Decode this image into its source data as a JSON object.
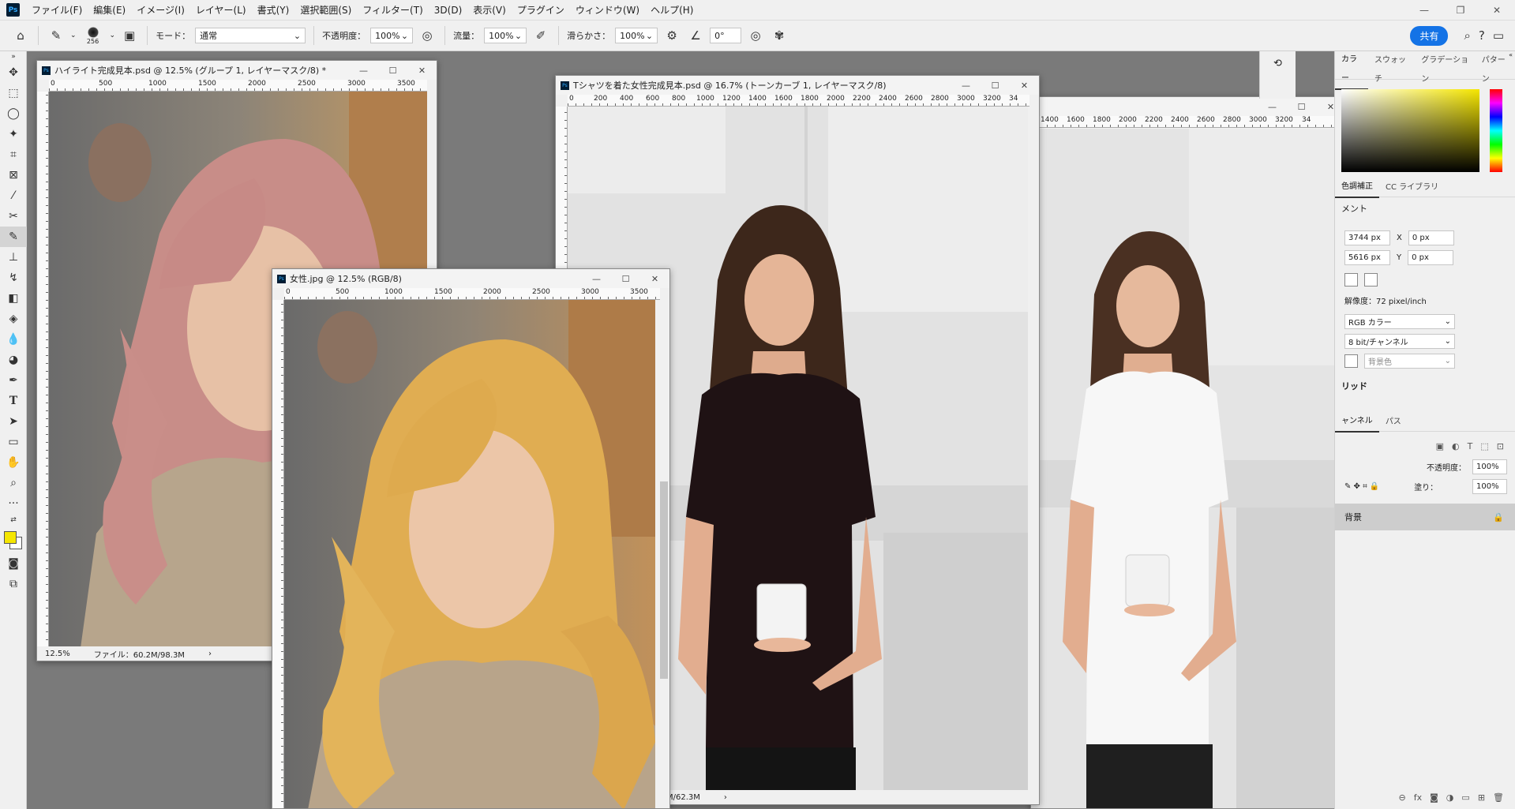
{
  "menubar": {
    "logo": "Ps",
    "items": [
      "ファイル(F)",
      "編集(E)",
      "イメージ(I)",
      "レイヤー(L)",
      "書式(Y)",
      "選択範囲(S)",
      "フィルター(T)",
      "3D(D)",
      "表示(V)",
      "プラグイン",
      "ウィンドウ(W)",
      "ヘルプ(H)"
    ]
  },
  "options": {
    "brush_size": "256",
    "mode_label": "モード：",
    "mode_value": "通常",
    "opacity_label": "不透明度：",
    "opacity_value": "100%",
    "flow_label": "流量：",
    "flow_value": "100%",
    "smoothing_label": "滑らかさ：",
    "smoothing_value": "100%",
    "angle_value": "0°",
    "share_label": "共有"
  },
  "docs": {
    "highlight": {
      "title": "ハイライト完成見本.psd @ 12.5% (グループ 1, レイヤーマスク/8) *",
      "ruler": [
        "0",
        "500",
        "1000",
        "1500",
        "2000",
        "2500",
        "3000",
        "3500"
      ],
      "zoom": "12.5%",
      "file": "ファイル：60.2M/98.3M"
    },
    "woman": {
      "title": "女性.jpg @ 12.5% (RGB/8)",
      "ruler": [
        "0",
        "500",
        "1000",
        "1500",
        "2000",
        "2500",
        "3000",
        "3500"
      ]
    },
    "tshirt": {
      "title": "Tシャツを着た女性完成見本.psd @ 16.7% (トーンカーブ 1, レイヤーマスク/8)",
      "ruler": [
        "0",
        "200",
        "400",
        "600",
        "800",
        "1000",
        "1200",
        "1400",
        "1600",
        "1800",
        "2000",
        "2200",
        "2400",
        "2600",
        "2800",
        "3000",
        "3200",
        "34"
      ],
      "file": "M/62.3M"
    },
    "white": {
      "ruler": [
        "1400",
        "1600",
        "1800",
        "2000",
        "2200",
        "2400",
        "2600",
        "2800",
        "3000",
        "3200",
        "34"
      ]
    }
  },
  "panel": {
    "tabs1": [
      "カラー",
      "スウォッチ",
      "グラデーション",
      "パターン"
    ],
    "tabs2": [
      "色調補正",
      "CC ライブラリ"
    ],
    "doc_heading": "メント",
    "width": "3744 px",
    "height": "5616 px",
    "x_label": "X",
    "x_value": "0 px",
    "y_label": "Y",
    "y_value": "0 px",
    "resolution": "解像度：72 pixel/inch",
    "color_mode": "RGB カラー",
    "bit_depth": "8 bit/チャンネル",
    "bg_option": "背景色",
    "grid_heading": "リッド",
    "tabs3": [
      "ャンネル",
      "パス"
    ],
    "opacity_label": "不透明度：",
    "opacity_value": "100%",
    "fill_label": "塗り：",
    "fill_value": "100%",
    "layer_name": "背景"
  },
  "colors": {
    "accent": "#1473e6",
    "foreground": "#f5e600",
    "background": "#ffffff"
  }
}
